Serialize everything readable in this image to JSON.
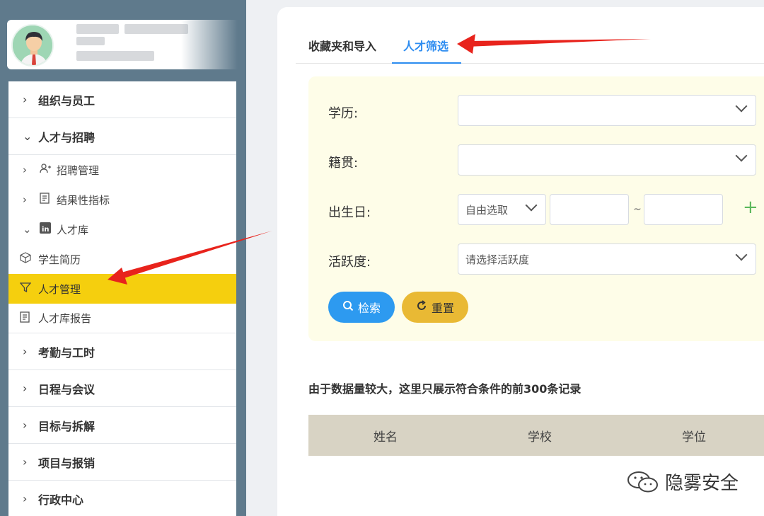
{
  "sidebar": {
    "groups_top": [
      {
        "label": "组织与员工"
      },
      {
        "label": "人才与招聘"
      }
    ],
    "sub_items": [
      {
        "label": "招聘管理",
        "icon": "user-add-icon"
      },
      {
        "label": "结果性指标",
        "icon": "document-icon"
      },
      {
        "label": "人才库",
        "icon": "linkedin-icon"
      }
    ],
    "leaves": [
      {
        "label": "学生简历",
        "icon": "cube-icon"
      },
      {
        "label": "人才管理",
        "icon": "filter-icon"
      },
      {
        "label": "人才库报告",
        "icon": "document-icon"
      }
    ],
    "groups_bottom": [
      {
        "label": "考勤与工时"
      },
      {
        "label": "日程与会议"
      },
      {
        "label": "目标与拆解"
      },
      {
        "label": "项目与报销"
      },
      {
        "label": "行政中心"
      }
    ]
  },
  "tabs": [
    {
      "label": "收藏夹和导入"
    },
    {
      "label": "人才筛选"
    }
  ],
  "filter": {
    "education_label": "学历:",
    "hometown_label": "籍贯:",
    "birthday_label": "出生日:",
    "birthday_mode": "自由选取",
    "range_separator": "~",
    "activity_label": "活跃度:",
    "activity_placeholder": "请选择活跃度",
    "search_label": "检索",
    "reset_label": "重置"
  },
  "note": "由于数据量较大，这里只展示符合条件的前300条记录",
  "table": {
    "columns": [
      "姓名",
      "学校",
      "学位"
    ]
  },
  "watermark": "隐雾安全",
  "colors": {
    "sidebar_bg": "#5f7a8c",
    "active_item": "#f5cf0e",
    "primary": "#2d9af0",
    "reset": "#e9b934",
    "filter_bg": "#fefde8",
    "table_header": "#d8d3c4",
    "annotation_arrow": "#e8231c"
  }
}
